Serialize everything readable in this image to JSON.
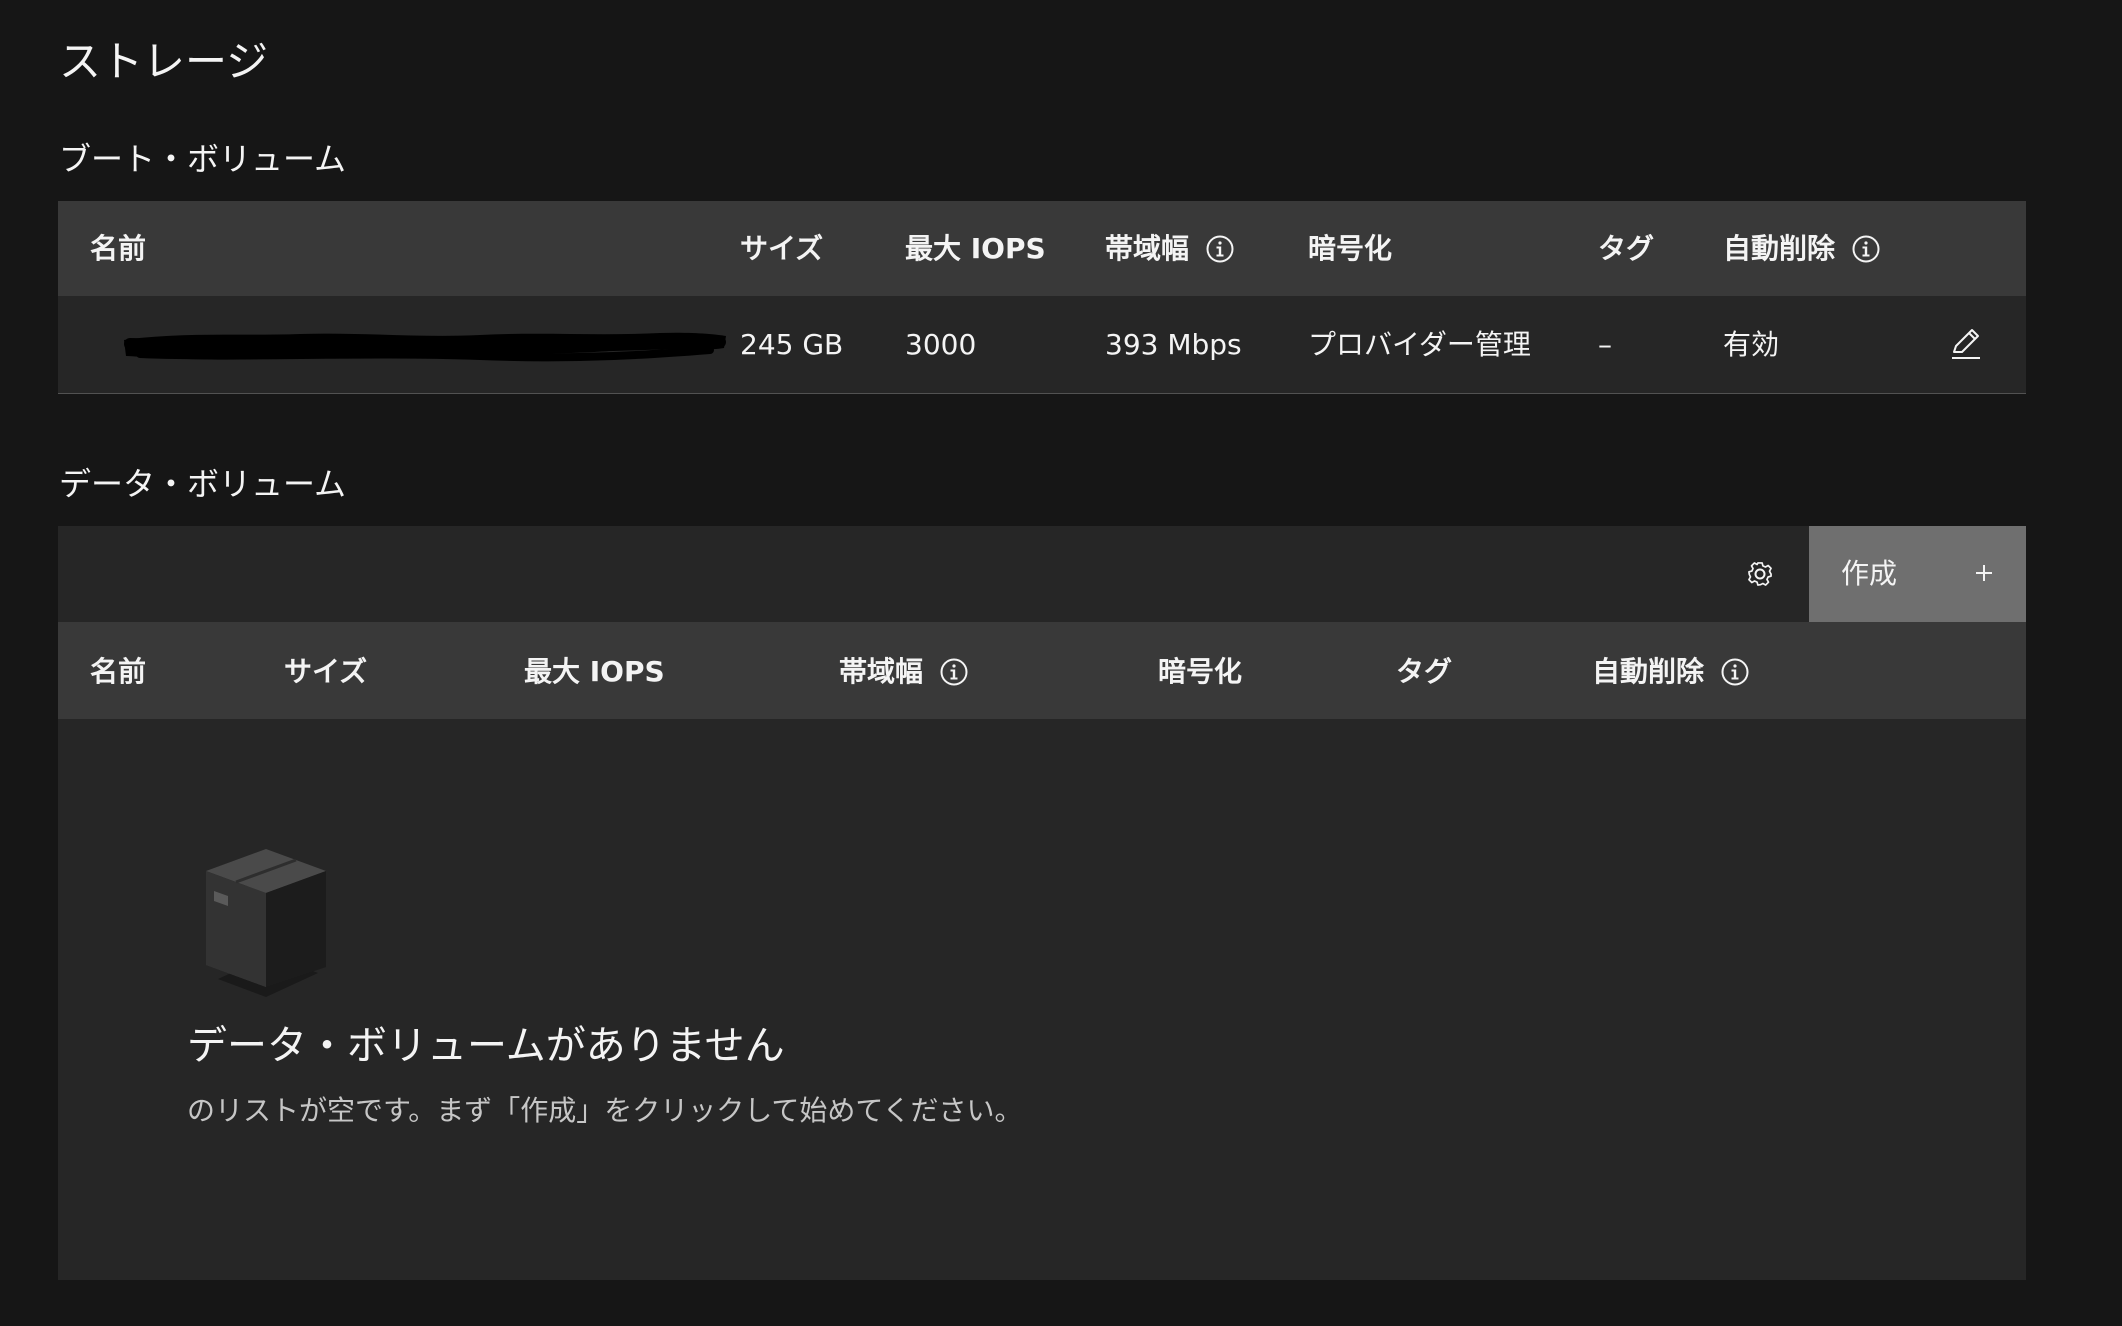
{
  "page": {
    "title": "ストレージ"
  },
  "boot_volumes": {
    "section_title": "ブート・ボリューム",
    "columns": {
      "name": "名前",
      "size": "サイズ",
      "max_iops": "最大 IOPS",
      "bandwidth": "帯域幅",
      "encryption": "暗号化",
      "tags": "タグ",
      "auto_delete": "自動削除"
    },
    "rows": [
      {
        "name": "",
        "size": "245 GB",
        "max_iops": "3000",
        "bandwidth": "393 Mbps",
        "encryption": "プロバイダー管理",
        "tags": "–",
        "auto_delete": "有効"
      }
    ]
  },
  "data_volumes": {
    "section_title": "データ・ボリューム",
    "toolbar": {
      "create_label": "作成"
    },
    "columns": {
      "name": "名前",
      "size": "サイズ",
      "max_iops": "最大 IOPS",
      "bandwidth": "帯域幅",
      "encryption": "暗号化",
      "tags": "タグ",
      "auto_delete": "自動削除"
    },
    "empty_state": {
      "title": "データ・ボリュームがありません",
      "description": "のリストが空です。まず「作成」をクリックして始めてください。"
    }
  },
  "icons": {
    "info": "info-icon",
    "edit": "edit-icon",
    "settings": "gear-icon",
    "add": "plus-icon",
    "empty": "box-icon"
  },
  "colors": {
    "background": "#161616",
    "table": "#262626",
    "header": "#393939",
    "primary_button": "#6f6f6f",
    "text": "#f4f4f4",
    "muted_text": "#c6c6c6"
  }
}
